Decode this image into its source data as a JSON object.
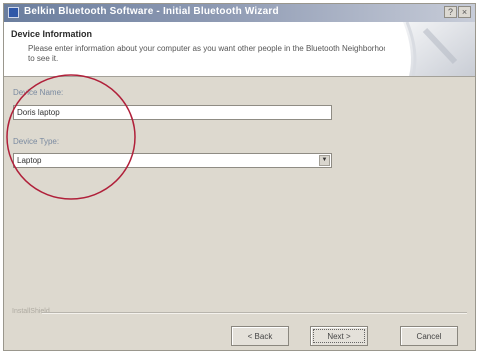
{
  "window": {
    "title": "Belkin Bluetooth Software - Initial Bluetooth Wizard",
    "controls": {
      "help": "?",
      "close": "×"
    }
  },
  "header": {
    "title": "Device Information",
    "description": "Please enter information about your computer as you want other people in the Bluetooth Neighborhood to see it."
  },
  "form": {
    "device_name_label": "Device Name:",
    "device_name_value": "Doris laptop",
    "device_type_label": "Device Type:",
    "device_type_value": "Laptop"
  },
  "footer": {
    "brand_label": "InstallShield",
    "back_label": "< Back",
    "next_label": "Next >",
    "cancel_label": "Cancel"
  },
  "annotation": {
    "color": "#b0203a"
  }
}
